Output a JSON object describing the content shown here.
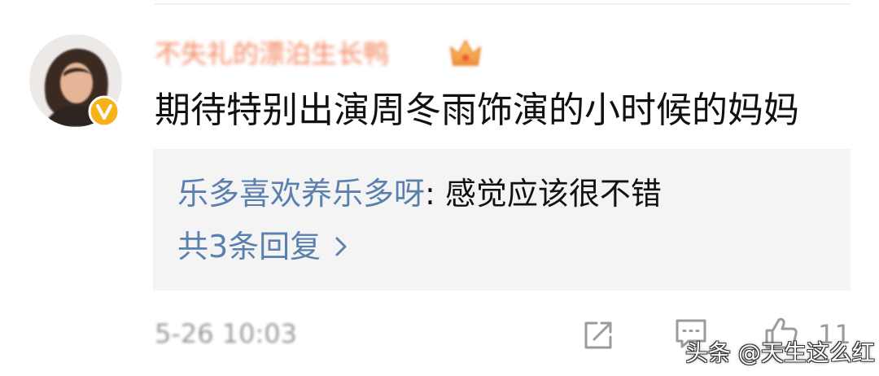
{
  "colors": {
    "username": "#f2875e",
    "link": "#5b80ad",
    "text": "#111111",
    "meta": "#9b9b9b",
    "reply_box_bg": "#f4f4f4",
    "verified_badge": "#f6b21b"
  },
  "icons": {
    "avatar": "user-avatar-icon",
    "verified": "verified-v-icon",
    "crown": "crown-icon",
    "chevron": "chevron-right-icon",
    "share": "share-icon",
    "comment": "comment-icon",
    "like": "thumbs-up-icon"
  },
  "comment": {
    "username": "不失礼的漂泊生长鸭",
    "text": "期待特别出演周冬雨饰演的小时候的妈妈",
    "timestamp": "5-26 10:03"
  },
  "reply_box": {
    "reply_author": "乐多喜欢养乐多呀",
    "reply_text": ": 感觉应该很不错",
    "more_replies": "共3条回复"
  },
  "actions": {
    "like_count": "11"
  },
  "watermark": "头条 @天生这么红"
}
